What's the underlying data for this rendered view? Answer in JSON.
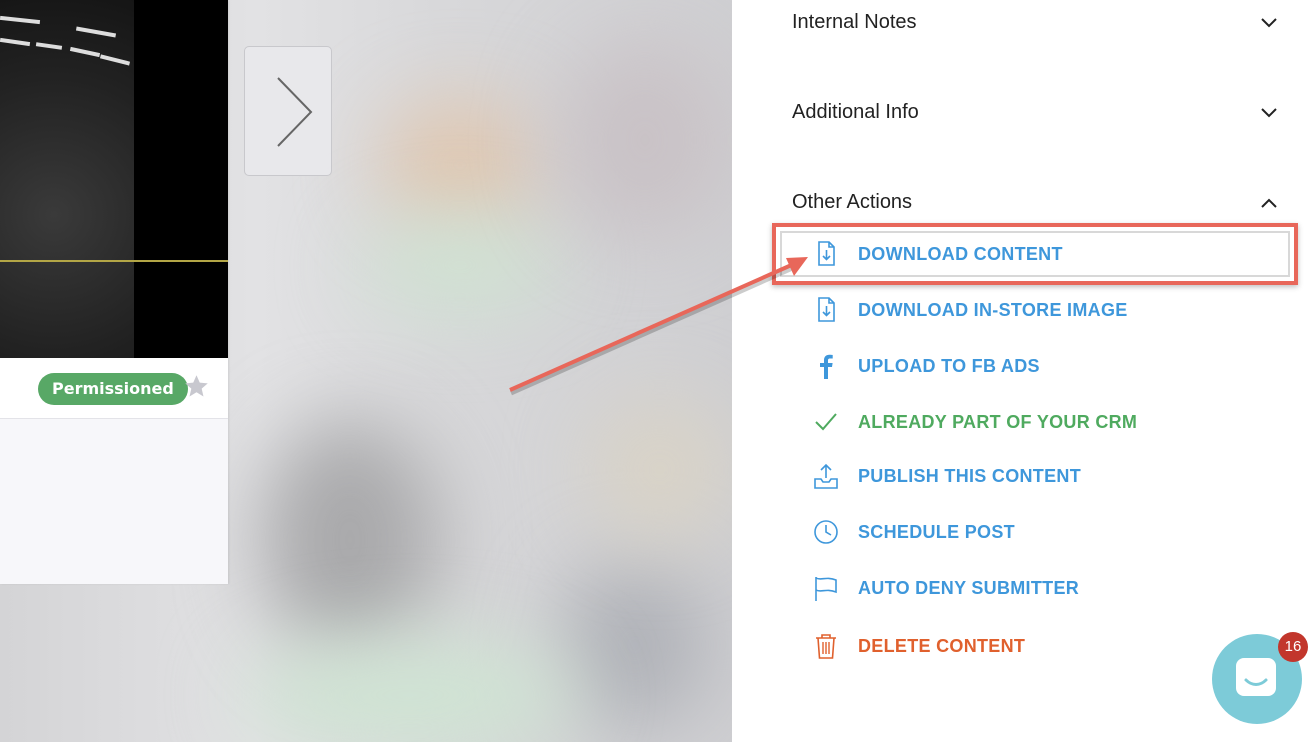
{
  "card": {
    "status_badge": "Permissioned"
  },
  "sections": [
    {
      "title": "Internal Notes",
      "state": "collapsed"
    },
    {
      "title": "Additional Info",
      "state": "collapsed"
    },
    {
      "title": "Other Actions",
      "state": "expanded"
    }
  ],
  "actions": [
    {
      "label": "DOWNLOAD CONTENT",
      "icon": "download-file-icon",
      "color": "#3e97db"
    },
    {
      "label": "DOWNLOAD IN-STORE IMAGE",
      "icon": "download-file-icon",
      "color": "#3e97db"
    },
    {
      "label": "UPLOAD TO FB ADS",
      "icon": "facebook-icon",
      "color": "#3e97db"
    },
    {
      "label": "ALREADY PART OF YOUR CRM",
      "icon": "checkmark-icon",
      "color": "#4faa5f"
    },
    {
      "label": "PUBLISH THIS CONTENT",
      "icon": "upload-tray-icon",
      "color": "#3e97db"
    },
    {
      "label": "SCHEDULE POST",
      "icon": "clock-icon",
      "color": "#3e97db"
    },
    {
      "label": "AUTO DENY SUBMITTER",
      "icon": "flag-icon",
      "color": "#3e97db"
    },
    {
      "label": "DELETE CONTENT",
      "icon": "trash-icon",
      "color": "#e0602d"
    }
  ],
  "chat": {
    "unread_count": "16"
  },
  "colors": {
    "accent_blue": "#3e97db",
    "success_green": "#4faa5f",
    "danger_orange": "#e0602d",
    "badge_green": "#58a866",
    "annotation_red": "#e8675a",
    "chat_teal": "#7dcbd8",
    "notification_red": "#c2362c"
  }
}
